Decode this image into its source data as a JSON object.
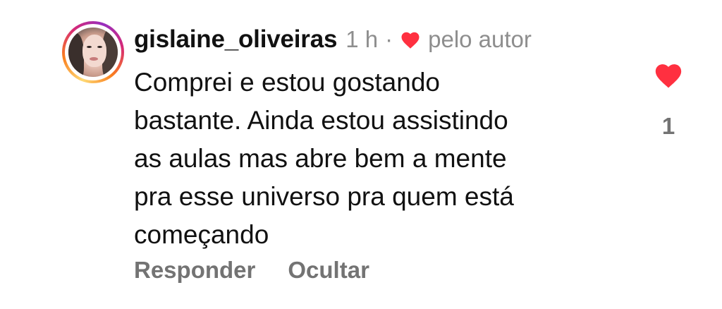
{
  "comment": {
    "username": "gislaine_oliveiras",
    "time": "1 h",
    "separator": "·",
    "liked_by_author_label": "pelo autor",
    "text_lines": [
      "Comprei e estou gostando",
      "bastante. Ainda estou assistindo",
      "as aulas mas abre bem a mente",
      "pra esse universo pra quem está",
      "começando"
    ],
    "reply_label": "Responder",
    "hide_label": "Ocultar",
    "like_count": "1"
  },
  "icons": {
    "author_like": "heart-icon",
    "like_button": "heart-icon",
    "avatar": "profile-photo"
  },
  "colors": {
    "heart": "#ff3040",
    "meta_text": "#8e8e8e",
    "action_text": "#737373",
    "main_text": "#111111"
  }
}
